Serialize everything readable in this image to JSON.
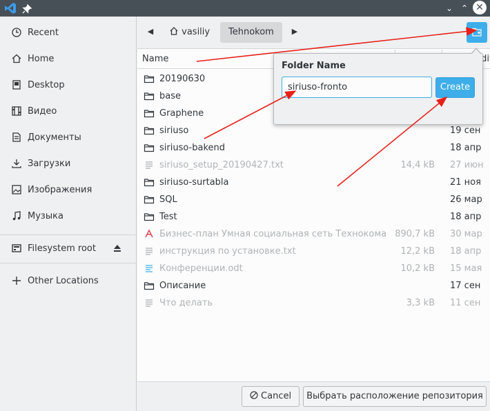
{
  "window": {
    "minimize_glyph": "⌄",
    "maximize_glyph": "⌃",
    "close_glyph": "✕"
  },
  "sidebar": {
    "items": [
      {
        "label": "Recent",
        "icon": "clock-icon"
      },
      {
        "label": "Home",
        "icon": "home-icon"
      },
      {
        "label": "Desktop",
        "icon": "desktop-icon"
      },
      {
        "label": "Видео",
        "icon": "video-icon"
      },
      {
        "label": "Документы",
        "icon": "document-icon"
      },
      {
        "label": "Загрузки",
        "icon": "download-icon"
      },
      {
        "label": "Изображения",
        "icon": "image-icon"
      },
      {
        "label": "Музыка",
        "icon": "music-icon"
      }
    ],
    "filesystem_root": "Filesystem root",
    "other_locations": "Other Locations"
  },
  "pathbar": {
    "home_crumb": "vasiliy",
    "current_crumb": "Tehnokom"
  },
  "columns": {
    "name": "Name",
    "modified": "Modified"
  },
  "files": [
    {
      "name": "20190630",
      "size": "",
      "date": "",
      "type": "folder",
      "dim": false
    },
    {
      "name": "base",
      "size": "",
      "date": "",
      "type": "folder",
      "dim": false
    },
    {
      "name": "Graphene",
      "size": "",
      "date": "",
      "type": "folder",
      "dim": false
    },
    {
      "name": "siriuso",
      "size": "",
      "date": "19 сен",
      "type": "folder",
      "dim": false
    },
    {
      "name": "siriuso-bakend",
      "size": "",
      "date": "18 апр",
      "type": "folder",
      "dim": false
    },
    {
      "name": "siriuso_setup_20190427.txt",
      "size": "14,4 kB",
      "date": "27 июн",
      "type": "text",
      "dim": true
    },
    {
      "name": "siriuso-surtabla",
      "size": "",
      "date": "21 ноя",
      "type": "folder",
      "dim": false
    },
    {
      "name": "SQL",
      "size": "",
      "date": "26 мар",
      "type": "folder",
      "dim": false
    },
    {
      "name": "Test",
      "size": "",
      "date": "18 апр",
      "type": "folder",
      "dim": false
    },
    {
      "name": "Бизнес-план Умная социальная сеть Технокома (в...",
      "size": "890,7 kB",
      "date": "30 мар",
      "type": "pdf",
      "dim": true
    },
    {
      "name": "инструкция по установке.txt",
      "size": "12,2 kB",
      "date": "18 апр",
      "type": "text",
      "dim": true
    },
    {
      "name": "Конференции.odt",
      "size": "10,2 kB",
      "date": "15 мая",
      "type": "odt",
      "dim": true
    },
    {
      "name": "Описание",
      "size": "",
      "date": "17 сен",
      "type": "folder",
      "dim": false
    },
    {
      "name": "Что делать",
      "size": "3,3 kB",
      "date": "11 сен",
      "type": "text",
      "dim": true
    }
  ],
  "popover": {
    "title": "Folder Name",
    "input_value": "siriuso-fronto",
    "create_label": "Create"
  },
  "buttons": {
    "cancel": "Cancel",
    "select": "Выбрать расположение репозитория"
  },
  "colors": {
    "accent": "#3daee9",
    "annotation": "#e8201a",
    "titlebar": "#475057"
  }
}
